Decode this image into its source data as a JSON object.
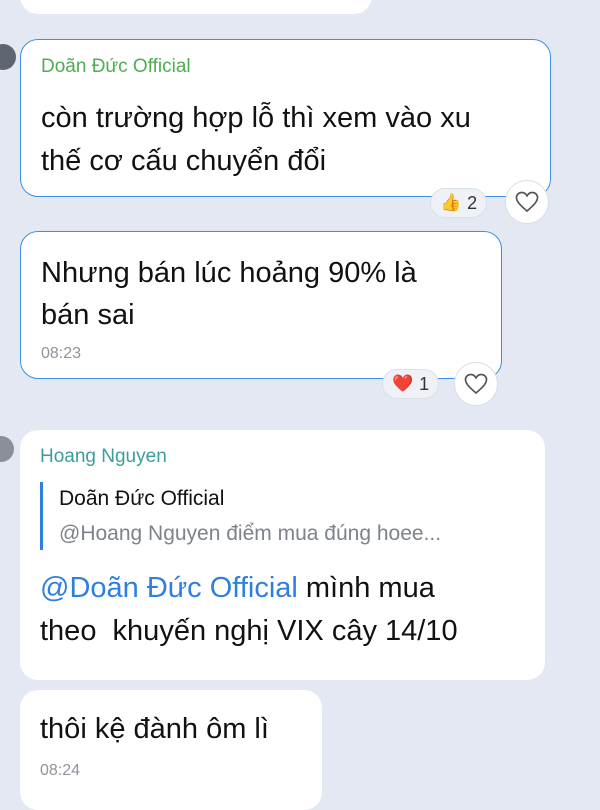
{
  "messages": [
    {
      "sender": "Doãn Đức Official",
      "text_lines": [
        "còn trường hợp lỗ thì xem vào xu",
        "thế cơ cấu chuyển đổi"
      ],
      "reaction": {
        "emoji": "👍",
        "count": "2"
      }
    },
    {
      "text_lines": [
        "Nhưng bán lúc hoảng 90% là",
        "bán sai"
      ],
      "time": "08:23",
      "reaction": {
        "emoji": "❤️",
        "count": "1"
      }
    },
    {
      "sender": "Hoang Nguyen",
      "quote": {
        "author": "Doãn Đức Official",
        "text": "@Hoang Nguyen  điểm mua đúng hoee..."
      },
      "mention": "@Doãn Đức Official",
      "text_line1_rest": " mình mua",
      "text_line2": "theo  khuyến nghị VIX cây 14/10"
    },
    {
      "text_lines": [
        "thôi kệ đành ôm lì"
      ],
      "time": "08:24"
    }
  ],
  "colors": {
    "background": "#e3e8f2",
    "highlight_border": "#3d8fe6",
    "sender_green": "#4caf50",
    "sender_teal": "#3a9e9a",
    "mention_blue": "#2f7fe0"
  }
}
